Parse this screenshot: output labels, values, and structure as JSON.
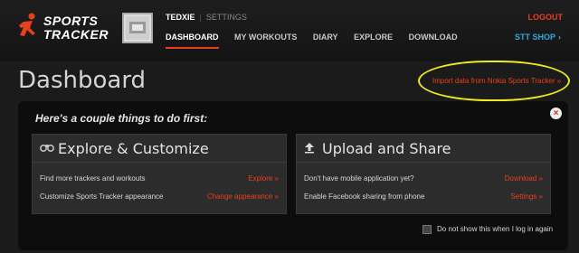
{
  "header": {
    "brand_line1": "SPORTS",
    "brand_line2": "TRACKER",
    "username": "TEDXIE",
    "settings_label": "SETTINGS",
    "logout_label": "LOGOUT",
    "nav": [
      {
        "label": "DASHBOARD",
        "active": true
      },
      {
        "label": "MY WORKOUTS"
      },
      {
        "label": "DIARY"
      },
      {
        "label": "EXPLORE"
      },
      {
        "label": "DOWNLOAD"
      }
    ],
    "shop_label": "STT SHOP",
    "shop_chevron": "›"
  },
  "main": {
    "title": "Dashboard",
    "import_link": "Import data from Nokia Sports Tracker »"
  },
  "panel": {
    "heading": "Here's a couple things to do first:",
    "close_glyph": "×",
    "explore_card": {
      "title": "Explore & Customize",
      "rows": [
        {
          "label": "Find more trackers and workouts",
          "link": "Explore »"
        },
        {
          "label": "Customize Sports Tracker appearance",
          "link": "Change appearance »"
        }
      ]
    },
    "upload_card": {
      "title": "Upload and Share",
      "rows": [
        {
          "label": "Don't have mobile application yet?",
          "link": "Download »"
        },
        {
          "label": "Enable Facebook sharing from phone",
          "link": "Settings »"
        }
      ]
    },
    "dont_show_label": "Do not show this when I log in again"
  },
  "colors": {
    "accent_orange": "#e8401c",
    "accent_blue": "#35a8dc",
    "highlight_yellow": "#f0e820"
  },
  "icons": {
    "logo": "runner-logo-icon",
    "explore": "binoculars-icon",
    "upload": "upload-arrow-icon",
    "close": "close-icon"
  }
}
